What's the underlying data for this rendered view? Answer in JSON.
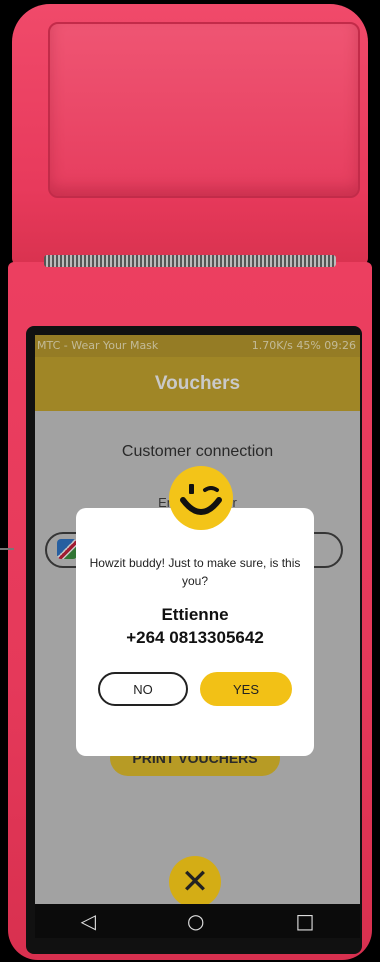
{
  "status_bar": {
    "left": "MTC - Wear Your Mask",
    "right": "1.70K/s  45%  09:26"
  },
  "app_bar": {
    "title": "Vouchers"
  },
  "page": {
    "section_title": "Customer connection",
    "enter_label": "Enter number",
    "print_button": "PRINT VOUCHERS"
  },
  "dialog": {
    "message": "Howzit buddy! Just to make sure, is this you?",
    "name": "Ettienne",
    "phone": "+264 0813305642",
    "no_label": "NO",
    "yes_label": "YES"
  },
  "close_button": {
    "label": "✕"
  },
  "nav": {
    "back": "◁",
    "home": "○",
    "recent": "□"
  },
  "colors": {
    "device": "#e83a5c",
    "accent_yellow": "#f2c116",
    "app_bar": "#c6a21e"
  }
}
